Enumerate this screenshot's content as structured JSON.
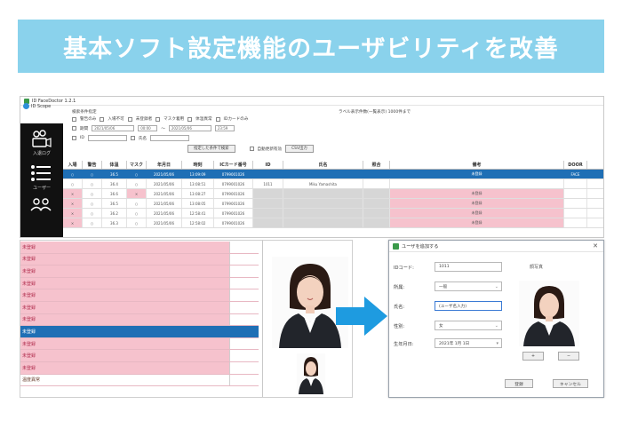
{
  "banner": {
    "title": "基本ソフト設定機能のユーザビリティを改善"
  },
  "colors": {
    "banner": "#8ad2ec",
    "selection": "#1f6fb5",
    "highlight_pink": "#f6c2cd",
    "arrow": "#1e9be0"
  },
  "app": {
    "window_title": "ID FaceDoctor  1.2.1",
    "logo_text": "ID Scope",
    "sidebar": [
      {
        "label": "入退ログ",
        "icon": "camera-users-icon"
      },
      {
        "label": "ユーザー",
        "icon": "list-icon"
      },
      {
        "label": "",
        "icon": "group-icon"
      }
    ],
    "filters": {
      "group_label": "検索条件指定",
      "checkboxes": [
        "警告のみ",
        "入場不可",
        "未登録者",
        "マスク着用",
        "体温異常",
        "IDカードのみ"
      ],
      "period_label": "期間",
      "date_from": "2021/05/06",
      "time_from": "00:00",
      "date_to": "2021/05/06",
      "time_to": "23:59",
      "id_label": "ID",
      "name_label": "氏名",
      "note": "ラベル表示件数(一覧表示) 1000件まで",
      "search_button": "指定した条件で検索",
      "auto_update_label": "自動更新有効",
      "export_button": "CSV出力"
    },
    "grid": {
      "headers": [
        "入場",
        "警告",
        "体温",
        "マスク",
        "年月日",
        "時刻",
        "ICカード番号",
        "ID",
        "氏名",
        "照合",
        "備考",
        "DOOR"
      ],
      "rows": [
        {
          "cells": [
            "○",
            "○",
            "36.5",
            "○",
            "2021/05/06",
            "13:09:09",
            "0799001026",
            "",
            "",
            "",
            "未登録",
            "FACE"
          ],
          "selected": true
        },
        {
          "cells": [
            "○",
            "○",
            "36.4",
            "○",
            "2021/05/06",
            "13:08:51",
            "0799001026",
            "1011",
            "Miku Yamashita",
            "",
            "",
            ""
          ],
          "selected": false
        },
        {
          "cells": [
            "×",
            "○",
            "36.6",
            "×",
            "2021/05/06",
            "13:08:27",
            "0799001026",
            "",
            "",
            "",
            "未登録",
            ""
          ],
          "selected": false
        },
        {
          "cells": [
            "×",
            "○",
            "36.5",
            "○",
            "2021/05/06",
            "13:08:05",
            "0799001026",
            "",
            "",
            "",
            "未登録",
            ""
          ],
          "selected": false
        },
        {
          "cells": [
            "×",
            "○",
            "36.2",
            "○",
            "2021/05/06",
            "12:58:41",
            "0799001026",
            "",
            "",
            "",
            "未登録",
            ""
          ],
          "selected": false
        },
        {
          "cells": [
            "×",
            "○",
            "36.3",
            "○",
            "2021/05/06",
            "12:58:02",
            "0799001026",
            "",
            "",
            "",
            "未登録",
            ""
          ],
          "selected": false
        }
      ]
    }
  },
  "list": {
    "rows": [
      {
        "label": "未登録",
        "state": "pink"
      },
      {
        "label": "未登録",
        "state": "pink"
      },
      {
        "label": "未登録",
        "state": "pink"
      },
      {
        "label": "未登録",
        "state": "pink"
      },
      {
        "label": "未登録",
        "state": "pink"
      },
      {
        "label": "未登録",
        "state": "pink"
      },
      {
        "label": "未登録",
        "state": "pink"
      },
      {
        "label": "未登録",
        "state": "selected"
      },
      {
        "label": "未登録",
        "state": "pink"
      },
      {
        "label": "未登録",
        "state": "pink"
      },
      {
        "label": "未登録",
        "state": "pink"
      },
      {
        "label": "温度異常",
        "state": "white"
      }
    ]
  },
  "dialog": {
    "title": "ユーザを追加する",
    "fields": [
      {
        "label": "IDコード:",
        "value": "1011"
      },
      {
        "label": "所属:",
        "value": "一般"
      },
      {
        "label": "氏名:",
        "value": "(ユーザ名入力)"
      },
      {
        "label": "性別:",
        "value": "女"
      },
      {
        "label": "生年月日:",
        "value": "2021年 1月 1日"
      }
    ],
    "photo_label": "顔写真",
    "add_photo_button": "+",
    "remove_photo_button": "−",
    "ok_button": "登録",
    "cancel_button": "キャンセル"
  }
}
